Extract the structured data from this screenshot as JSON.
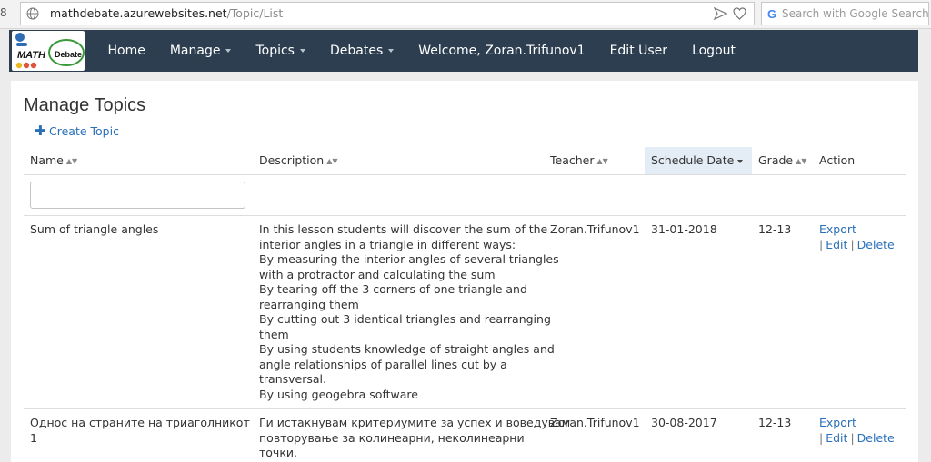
{
  "browser": {
    "url_host": "mathdebate.azurewebsites.net",
    "url_path": "/Topic/List",
    "search_placeholder": "Search with Google Search"
  },
  "logo": {
    "text_math": "MATH",
    "text_debate": "Debate"
  },
  "nav": [
    {
      "label": "Home",
      "dropdown": false
    },
    {
      "label": "Manage",
      "dropdown": true
    },
    {
      "label": "Topics",
      "dropdown": true
    },
    {
      "label": "Debates",
      "dropdown": true
    },
    {
      "label": "Welcome, Zoran.Trifunov1",
      "dropdown": false
    },
    {
      "label": "Edit User",
      "dropdown": false
    },
    {
      "label": "Logout",
      "dropdown": false
    }
  ],
  "page": {
    "title": "Manage Topics",
    "create_label": "Create Topic"
  },
  "table": {
    "columns": [
      "Name",
      "Description",
      "Teacher",
      "Schedule Date",
      "Grade",
      "Action"
    ],
    "rows": [
      {
        "name": "Sum of triangle angles",
        "description": [
          "In this lesson students will discover the sum of the",
          "interior angles in a triangle in different ways:",
          "By measuring the interior angles of several triangles",
          "with a protractor and calculating the sum",
          "By tearing off the 3 corners of one triangle and",
          "rearranging them",
          "By cutting out 3 identical triangles and rearranging",
          "them",
          "By using students knowledge of straight angles and",
          "angle relationships of parallel lines cut by a",
          "transversal.",
          "By using geogebra software"
        ],
        "teacher": "Zoran.Trifunov1",
        "date": "31-01-2018",
        "grade": "12-13",
        "actions": {
          "export": "Export",
          "edit": "Edit",
          "delete": "Delete"
        }
      },
      {
        "name": "Однос на страните на триаголникот 1",
        "description": [
          "Ги истакнувам критериумите за успех и воведувам",
          "повторување за колинеарни, неколинеарни",
          "точки."
        ],
        "teacher": "Zoran.Trifunov1",
        "date": "30-08-2017",
        "grade": "12-13",
        "actions": {
          "export": "Export",
          "edit": "Edit",
          "delete": "Delete"
        }
      }
    ]
  },
  "colors": {
    "navbar": "#2c3e50",
    "link": "#2a6fb8",
    "sorted_header": "#e4ecf6"
  }
}
